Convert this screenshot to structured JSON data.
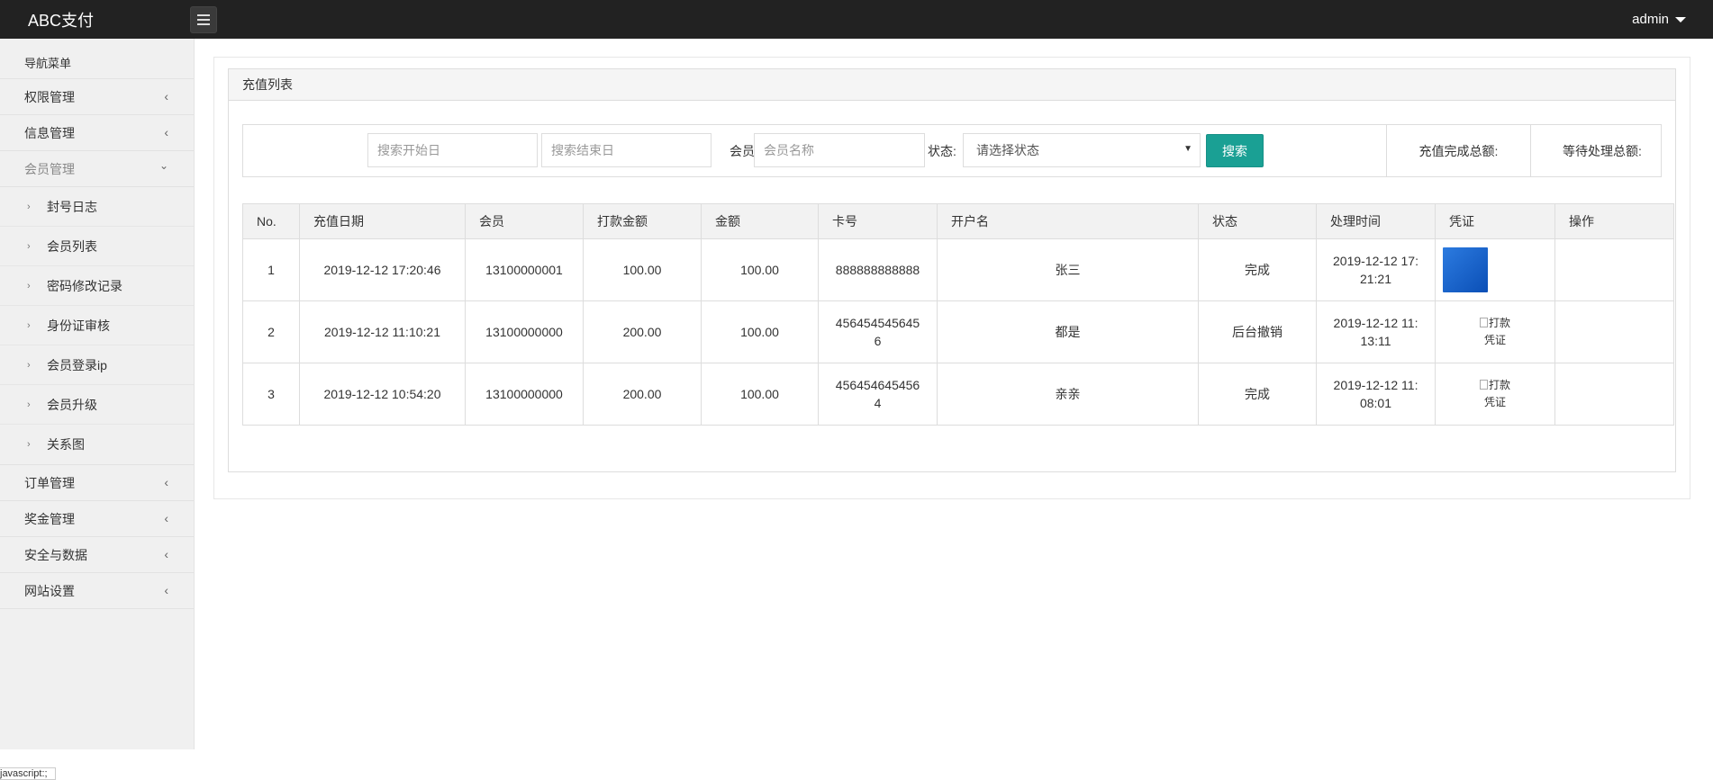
{
  "app": {
    "brand": "ABC支付",
    "user": "admin"
  },
  "sidebar": {
    "header": "导航菜单",
    "items_top": [
      {
        "label": "权限管理"
      },
      {
        "label": "信息管理"
      }
    ],
    "member": {
      "label": "会员管理",
      "children": [
        {
          "label": "封号日志"
        },
        {
          "label": "会员列表"
        },
        {
          "label": "密码修改记录"
        },
        {
          "label": "身份证审核"
        },
        {
          "label": "会员登录ip"
        },
        {
          "label": "会员升级"
        },
        {
          "label": "关系图"
        }
      ]
    },
    "items_bottom": [
      {
        "label": "订单管理"
      },
      {
        "label": "奖金管理"
      },
      {
        "label": "安全与数据"
      },
      {
        "label": "网站设置"
      }
    ],
    "icons": {
      "collapsed": "chevron-left-icon",
      "expanded": "chevron-down-icon",
      "child": "chevron-right-icon"
    }
  },
  "panel": {
    "title": "充值列表"
  },
  "search": {
    "start_placeholder": "搜索开始日",
    "end_placeholder": "搜索结束日",
    "member_label": "会员:",
    "member_placeholder": "会员名称",
    "status_label": "状态:",
    "status_selected": "请选择状态",
    "button": "搜索",
    "total_done_label": "充值完成总额:",
    "total_pending_label": "等待处理总额:"
  },
  "table": {
    "headers": [
      "No.",
      "充值日期",
      "会员",
      "打款金额",
      "金额",
      "卡号",
      "开户名",
      "状态",
      "处理时间",
      "凭证",
      "操作"
    ],
    "rows": [
      {
        "no": "1",
        "date": "2019-12-12 17:20:46",
        "member": "13100000001",
        "paid": "100.00",
        "amount": "100.00",
        "card": "888888888888",
        "name": "张三",
        "status": "完成",
        "time_a": "2019-12-12 17:",
        "time_b": "21:21",
        "voucher": "",
        "voucher_type": "image"
      },
      {
        "no": "2",
        "date": "2019-12-12 11:10:21",
        "member": "13100000000",
        "paid": "200.00",
        "amount": "100.00",
        "card_a": "456454545645",
        "card_b": "6",
        "name": "都是",
        "status": "后台撤销",
        "time_a": "2019-12-12 11:",
        "time_b": "13:11",
        "voucher_a": "打款",
        "voucher_b": "凭证"
      },
      {
        "no": "3",
        "date": "2019-12-12 10:54:20",
        "member": "13100000000",
        "paid": "200.00",
        "amount": "100.00",
        "card_a": "456454645456",
        "card_b": "4",
        "name": "亲亲",
        "status": "完成",
        "time_a": "2019-12-12 11:",
        "time_b": "08:01",
        "voucher_a": "打款",
        "voucher_b": "凭证"
      }
    ]
  },
  "statusbar": {
    "text": "javascript:;"
  },
  "colors": {
    "topbar": "#222222",
    "sidebar": "#f0f0f0",
    "accent": "#1aa094"
  }
}
